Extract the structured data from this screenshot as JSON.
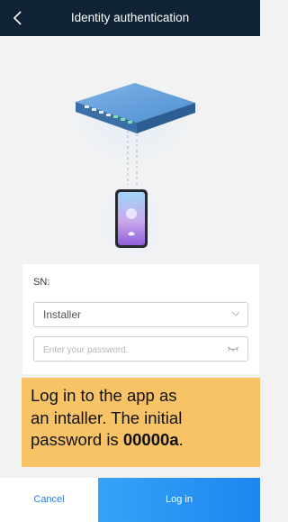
{
  "header": {
    "title": "Identity authentication",
    "back_icon": "chevron-left-icon"
  },
  "form": {
    "sn_label": "SN:",
    "account_selected": "Installer",
    "password_placeholder": "Enter your password.",
    "password_value": ""
  },
  "note": {
    "line1": "Log in to the app as",
    "line2": "an intaller. The initial",
    "line3_prefix": "password is ",
    "line3_bold": "00000a",
    "line3_suffix": "."
  },
  "actions": {
    "cancel_label": "Cancel",
    "login_label": "Log in"
  },
  "colors": {
    "header_bg": "#0f2236",
    "accent_blue": "#2f7ed8",
    "note_bg": "#f8c366",
    "login_gradient_start": "#36a3f7",
    "login_gradient_end": "#1d86ef"
  }
}
